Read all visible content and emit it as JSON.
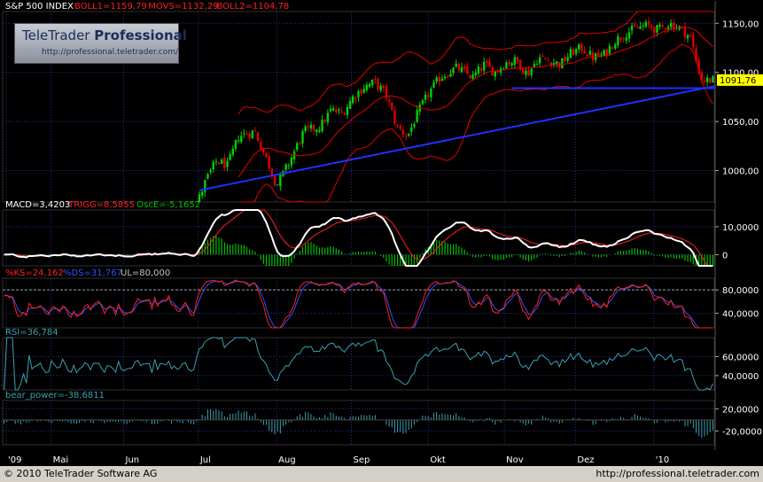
{
  "logo": {
    "title_plain": "TeleTrader ",
    "title_bold": "Professional",
    "url": "http://professional.teletrader.com/"
  },
  "footer": {
    "left": "© 2010 TeleTrader Software AG",
    "right": "http://professional.teletrader.com"
  },
  "colors": {
    "up": "#00d000",
    "down": "#e00000",
    "boll": "#e00000",
    "trend": "#2030ff",
    "grid": "#2a2a8a",
    "macd": "#ffffff",
    "trigg": "#ff2020",
    "osc": "#00c000",
    "ks": "#ff2020",
    "ds": "#3050ff",
    "rsi": "#3aa0b0",
    "bear": "#3aa0b0"
  },
  "x_labels": [
    {
      "label": "'09",
      "frac": 0.005
    },
    {
      "label": "Mai",
      "frac": 0.068
    },
    {
      "label": "Jun",
      "frac": 0.17
    },
    {
      "label": "Jul",
      "frac": 0.275
    },
    {
      "label": "Aug",
      "frac": 0.385
    },
    {
      "label": "Sep",
      "frac": 0.49
    },
    {
      "label": "Okt",
      "frac": 0.598
    },
    {
      "label": "Nov",
      "frac": 0.705
    },
    {
      "label": "Dez",
      "frac": 0.805
    },
    {
      "label": "'10",
      "frac": 0.915
    }
  ],
  "chart_data": [
    {
      "type": "candlestick",
      "title": "S&P 500 INDEX",
      "legend": [
        {
          "text": "BOLL1=1159,79",
          "color": "#ff2020"
        },
        {
          "text": "MOVS=1132,29",
          "color": "#ff2020"
        },
        {
          "text": "BOLL2=1104,78",
          "color": "#ff2020"
        }
      ],
      "ylim": [
        968,
        1162
      ],
      "yticks": [
        1000,
        1050,
        1100,
        1150
      ],
      "ytick_labels": [
        "1000,00",
        "1050,00",
        "1100,00",
        "1150,00"
      ],
      "last_value": 1091.76,
      "last_label": "1091,76",
      "close_path": [
        [
          0.0,
          955
        ],
        [
          0.35,
          955
        ],
        [
          0.355,
          968
        ],
        [
          0.37,
          990
        ],
        [
          0.39,
          1010
        ],
        [
          0.41,
          1005
        ],
        [
          0.43,
          1035
        ],
        [
          0.46,
          1040
        ],
        [
          0.49,
          1000
        ],
        [
          0.5,
          985
        ],
        [
          0.52,
          1005
        ],
        [
          0.55,
          1040
        ],
        [
          0.58,
          1045
        ],
        [
          0.6,
          1062
        ],
        [
          0.62,
          1058
        ],
        [
          0.64,
          1075
        ],
        [
          0.66,
          1085
        ],
        [
          0.68,
          1090
        ],
        [
          0.7,
          1078
        ],
        [
          0.72,
          1045
        ],
        [
          0.74,
          1035
        ],
        [
          0.76,
          1060
        ],
        [
          0.78,
          1080
        ],
        [
          0.8,
          1095
        ],
        [
          0.83,
          1105
        ],
        [
          0.86,
          1095
        ],
        [
          0.88,
          1108
        ],
        [
          0.9,
          1100
        ],
        [
          0.92,
          1110
        ],
        [
          0.94,
          1112
        ],
        [
          0.96,
          1098
        ],
        [
          0.98,
          1115
        ],
        [
          1.0,
          1112
        ],
        [
          1.02,
          1108
        ],
        [
          1.04,
          1120
        ],
        [
          1.06,
          1125
        ],
        [
          1.08,
          1115
        ],
        [
          1.1,
          1118
        ],
        [
          1.12,
          1132
        ],
        [
          1.14,
          1140
        ],
        [
          1.16,
          1145
        ],
        [
          1.18,
          1148
        ],
        [
          1.2,
          1143
        ],
        [
          1.22,
          1150
        ],
        [
          1.24,
          1145
        ],
        [
          1.26,
          1135
        ],
        [
          1.27,
          1110
        ],
        [
          1.28,
          1092
        ]
      ],
      "trendline": [
        [
          0.36,
          980
        ],
        [
          1.3,
          1086
        ]
      ],
      "support": [
        [
          0.93,
          1084
        ],
        [
          1.3,
          1084
        ]
      ]
    },
    {
      "type": "line+bar",
      "title": "MACD",
      "legend": [
        {
          "text": "MACD=3,4203",
          "color": "#ffffff"
        },
        {
          "text": "TRIGG=8,5855",
          "color": "#ff2020"
        },
        {
          "text": "OscE=-5,1652",
          "color": "#00c000"
        }
      ],
      "ylim": [
        -4,
        16
      ],
      "yticks": [
        0,
        10
      ],
      "ytick_labels": [
        "0",
        "10,0000"
      ]
    },
    {
      "type": "line",
      "title": "Stochastic",
      "legend": [
        {
          "text": "%KS=24,162",
          "color": "#ff2020"
        },
        {
          "text": "%DS=31,767",
          "color": "#3050ff"
        },
        {
          "text": "UL=80,000",
          "color": "#c0c0c0"
        }
      ],
      "ylim": [
        15,
        100
      ],
      "yticks": [
        40,
        80
      ],
      "ytick_labels": [
        "40,0000",
        "80,0000"
      ],
      "upper_level": 80
    },
    {
      "type": "line",
      "title": "RSI",
      "legend": [
        {
          "text": "RSI=36,784",
          "color": "#3aa0b0"
        }
      ],
      "ylim": [
        25,
        80
      ],
      "yticks": [
        40,
        60
      ],
      "ytick_labels": [
        "40,0000",
        "60,0000"
      ]
    },
    {
      "type": "bar",
      "title": "bear_power",
      "legend": [
        {
          "text": "bear_power=-38,6811",
          "color": "#3aa0b0"
        }
      ],
      "ylim": [
        -45,
        35
      ],
      "yticks": [
        -20,
        20
      ],
      "ytick_labels": [
        "-20,0000",
        "20,0000"
      ]
    }
  ]
}
